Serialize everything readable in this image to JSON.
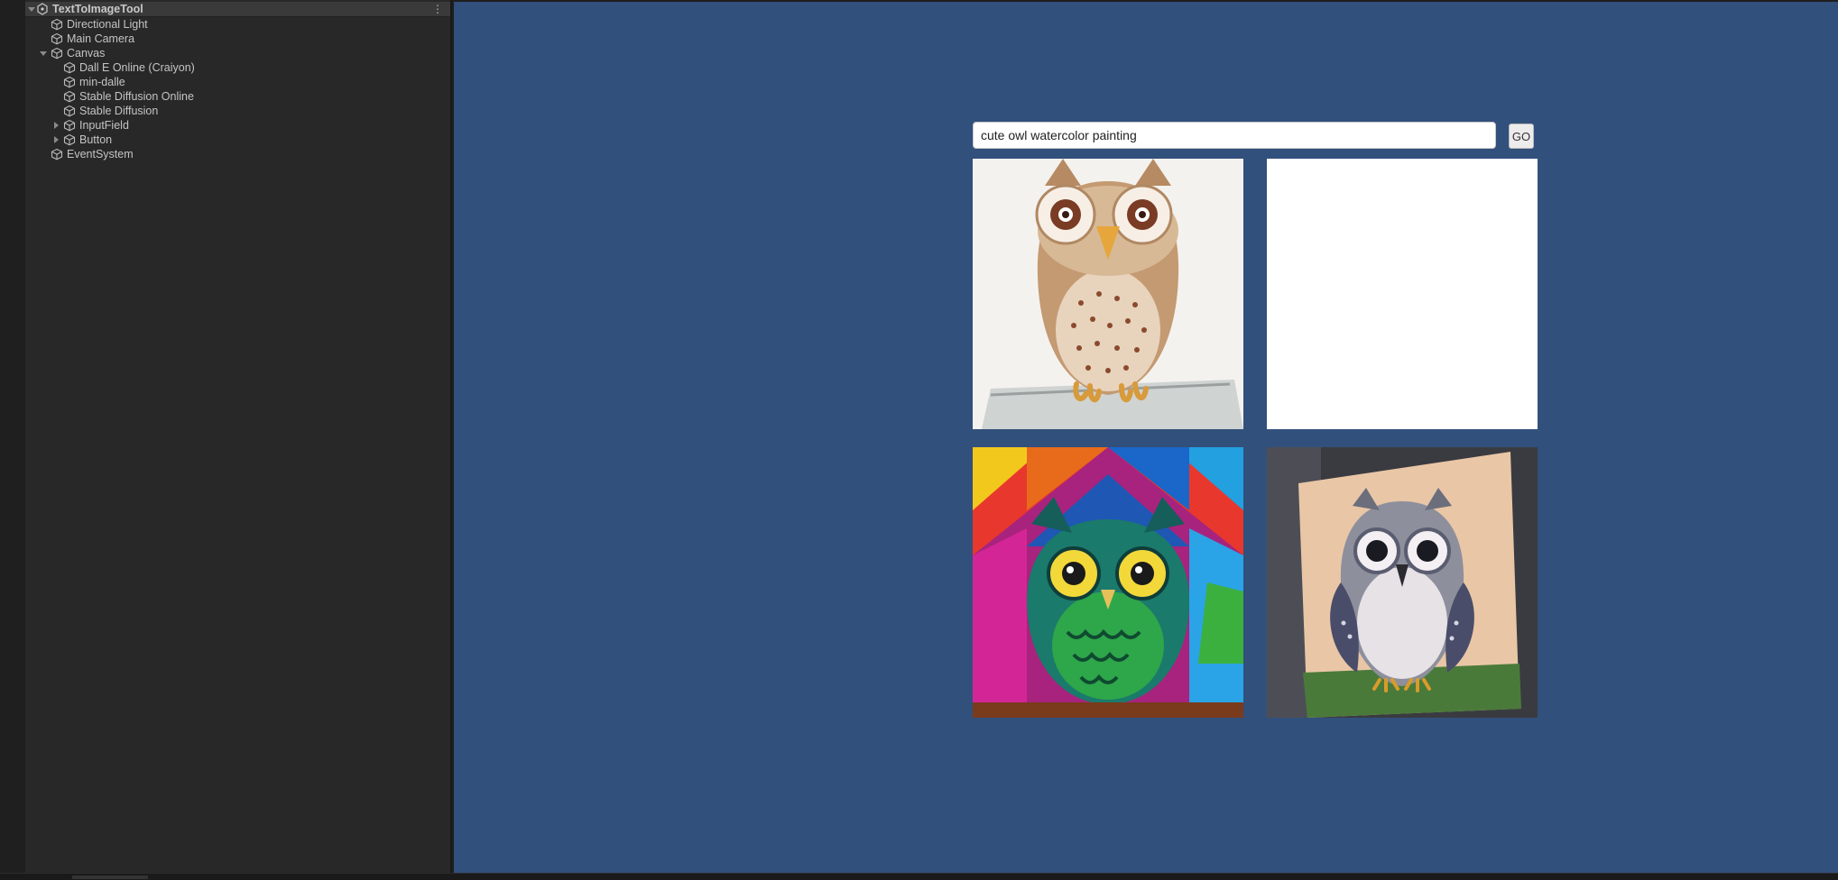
{
  "hierarchy": {
    "root": "TextToImageTool",
    "items": [
      {
        "label": "Directional Light"
      },
      {
        "label": "Main Camera"
      },
      {
        "label": "Canvas"
      },
      {
        "label": "Dall E Online (Craiyon)"
      },
      {
        "label": "min-dalle"
      },
      {
        "label": "Stable Diffusion Online"
      },
      {
        "label": "Stable Diffusion"
      },
      {
        "label": "InputField"
      },
      {
        "label": "Button"
      },
      {
        "label": "EventSystem"
      }
    ]
  },
  "game": {
    "prompt_value": "cute owl watercolor painting",
    "go_label": "GO",
    "images": [
      {
        "icon": "owl-brown-watercolor-image"
      },
      {
        "icon": "blank-white-image"
      },
      {
        "icon": "owl-colorful-watercolor-image"
      },
      {
        "icon": "owl-gray-watercolor-image"
      }
    ]
  },
  "colors": {
    "game_background": "#32507c",
    "panel_background": "#282828"
  }
}
